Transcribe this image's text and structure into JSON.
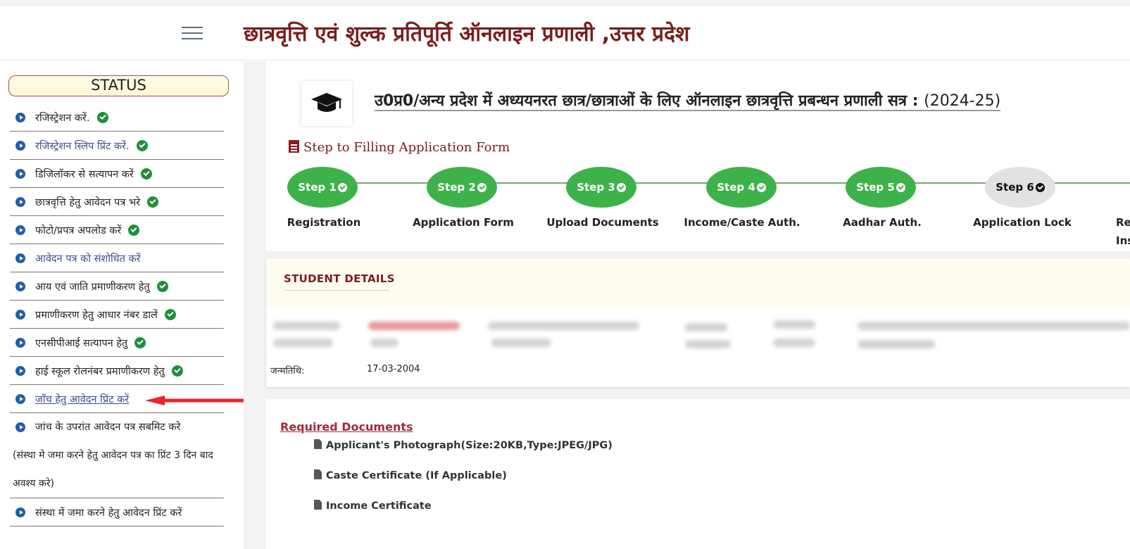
{
  "header": {
    "title": "छात्रवृत्ति एवं शुल्क प्रतिपूर्ति ऑनलाइन प्रणाली ,उत्तर प्रदेश"
  },
  "sidebar": {
    "status_title": "STATUS",
    "items": [
      {
        "label": "रजिस्ट्रेशन करें.",
        "done": true
      },
      {
        "label": "रजिस्ट्रेशन स्लिप प्रिंट करें.",
        "done": true
      },
      {
        "label": "डिजिलॉकर से सत्यापन करें",
        "done": true
      },
      {
        "label": "छात्रवृत्ति हेतु आवेदन पत्र भरे",
        "done": true
      },
      {
        "label": "फोटो/प्रपत्र अपलोड करें",
        "done": true
      },
      {
        "label": "आवेदन पत्र को संशोधित करें",
        "done": false
      },
      {
        "label": "आय एवं जाति प्रमाणीकरण हेतु",
        "done": true
      },
      {
        "label": "प्रमाणीकरण हेतु आधार नंबर डालें",
        "done": true
      },
      {
        "label": "एनसीपीआई सत्यापन हेतु",
        "done": true
      },
      {
        "label": "हाई स्कूल रोलनंबर प्रमाणीकरण हेतु",
        "done": true
      },
      {
        "label": "जाँच हेतु आवेदन प्रिंट करें",
        "done": false
      },
      {
        "label": "जांच के उपरांत आवेदन पत्र सबमिट करे",
        "note": "(संस्था मे जमा करने हेतु आवेदन पत्र का प्रिंट 3 दिन बाद अवश्य करे)",
        "done": false
      },
      {
        "label": "संस्था में जमा करने हेतु आवेदन प्रिंट करें",
        "done": false
      }
    ]
  },
  "main": {
    "title_prefix": "उ0प्र0/अन्य प्रदेश में अध्ययनरत छात्र/छात्राओं के लिए ऑनलाइन छात्रवृत्ति प्रबन्धन प्रणाली सत्र : ",
    "session": "(2024-25)",
    "steps_heading": "Step to Filling Application Form",
    "steps": [
      {
        "name": "Step 1",
        "label": "Registration",
        "done": true
      },
      {
        "name": "Step 2",
        "label": "Application Form",
        "done": true
      },
      {
        "name": "Step 3",
        "label": "Upload Documents",
        "done": true
      },
      {
        "name": "Step 4",
        "label": "Income/Caste Auth.",
        "done": true
      },
      {
        "name": "Step 5",
        "label": "Aadhar Auth.",
        "done": true
      },
      {
        "name": "Step 6",
        "label": "Application Lock",
        "done": false
      }
    ],
    "step7_partial": {
      "line1": "Re",
      "line2": "Ins"
    },
    "student": {
      "title": "STUDENT DETAILS",
      "dob_label": "जन्मतिथि:",
      "dob_value": "17-03-2004"
    },
    "docs": {
      "title": "Required Documents",
      "items": [
        "Applicant's Photograph(Size:20KB,Type:JPEG/JPG)",
        "Caste Certificate (If Applicable)",
        "Income Certificate"
      ]
    }
  },
  "colors": {
    "title": "#7a1d1d",
    "step_done": "#3eb24a",
    "step_pending": "#e2e2e2",
    "check": "#1f8f3a",
    "bullet": "#1f5fa8",
    "arrow": "#e8252b"
  }
}
